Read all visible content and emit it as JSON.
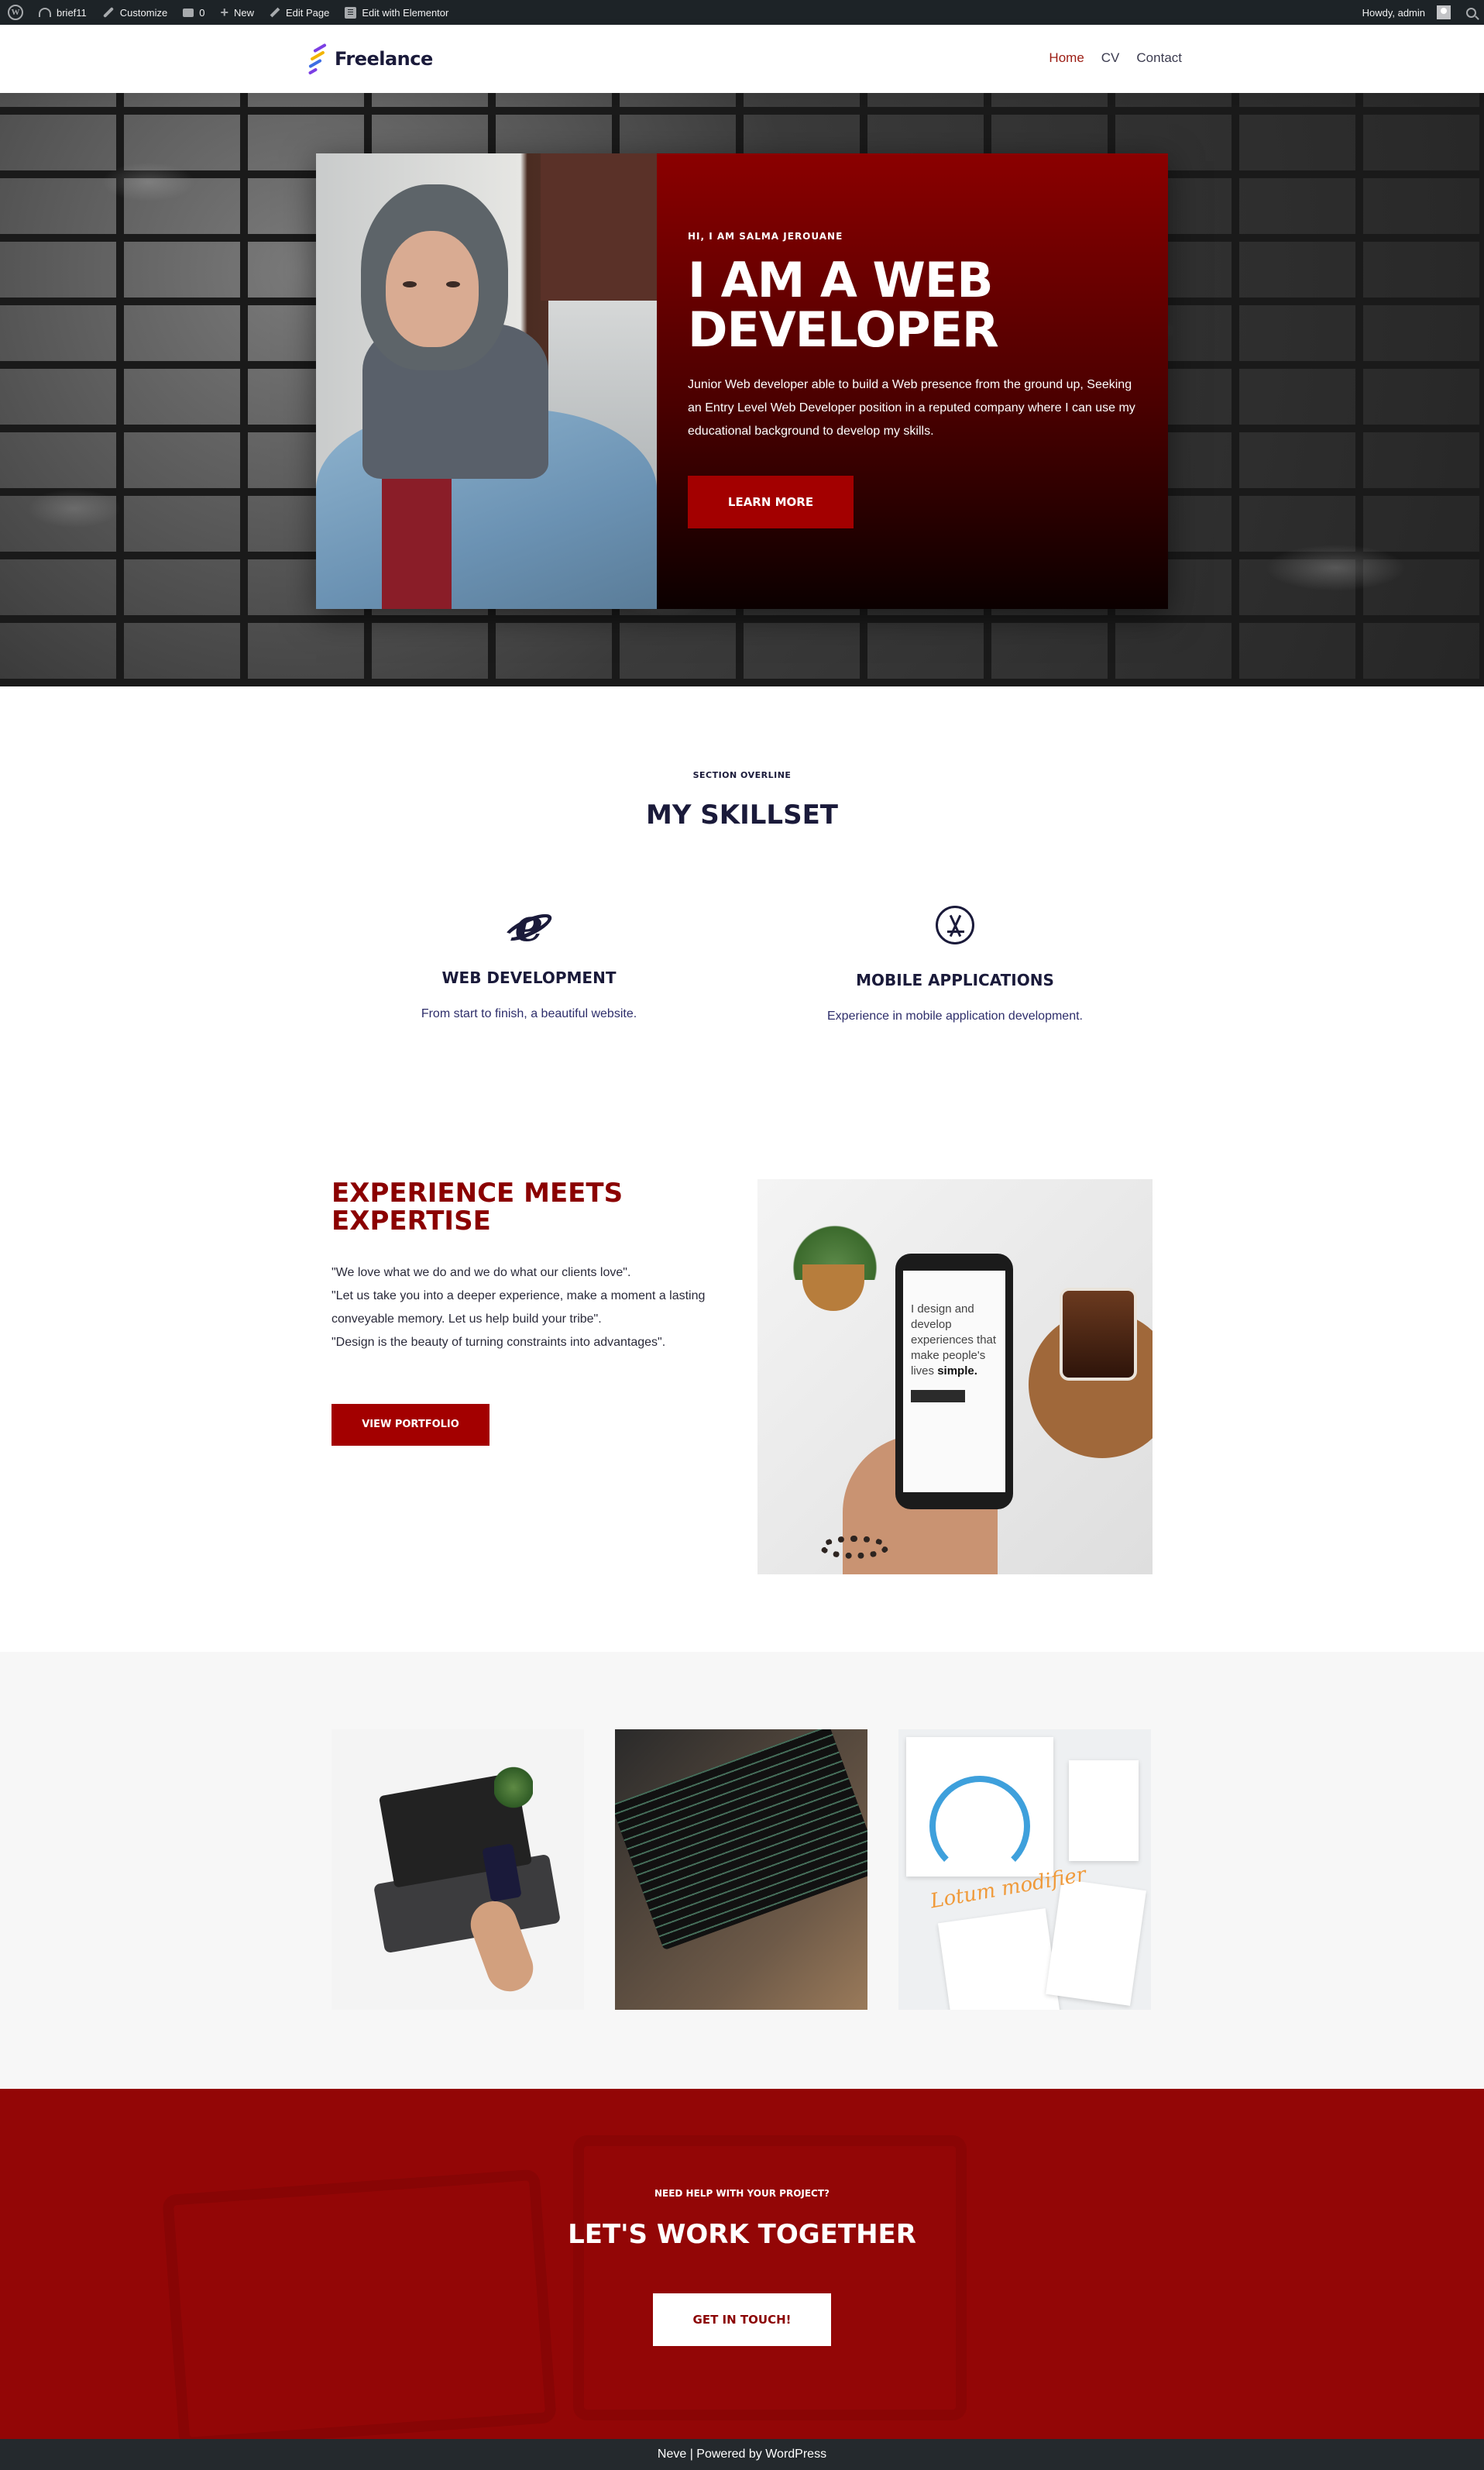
{
  "admin_bar": {
    "site_name": "brief11",
    "customize": "Customize",
    "comments_count": "0",
    "new": "New",
    "edit_page": "Edit Page",
    "edit_elementor": "Edit with Elementor",
    "howdy": "Howdy, admin"
  },
  "header": {
    "logo_text": "Freelance",
    "nav": [
      {
        "label": "Home",
        "active": true
      },
      {
        "label": "CV",
        "active": false
      },
      {
        "label": "Contact",
        "active": false
      }
    ]
  },
  "hero": {
    "kicker": "HI, I AM SALMA JEROUANE",
    "title": "I AM A WEB DEVELOPER",
    "text": "Junior Web developer able to build a Web presence from the ground up, Seeking an Entry Level Web Developer position in a reputed company where I can use my educational background to develop my skills.",
    "button": "LEARN MORE"
  },
  "skillset": {
    "overline": "SECTION OVERLINE",
    "title": "MY SKILLSET",
    "items": [
      {
        "icon": "internet-explorer-icon",
        "title": "WEB DEVELOPMENT",
        "text": "From start to finish, a beautiful website."
      },
      {
        "icon": "app-store-icon",
        "title": "MOBILE APPLICATIONS",
        "text": "Experience in mobile application development."
      }
    ]
  },
  "experience": {
    "title": "EXPERIENCE MEETS EXPERTISE",
    "quotes": [
      "\"We love what we do and we do what our clients love\".",
      "\"Let us take you into a deeper experience, make a moment a lasting conveyable memory. Let us help build your tribe\".",
      "\"Design is the beauty of turning constraints into advantages\"."
    ],
    "button": "VIEW PORTFOLIO",
    "phone_text": "I design and develop experiences that make people's lives",
    "phone_bold": "simple."
  },
  "gallery": {
    "script_text": "Lotum modifier"
  },
  "cta": {
    "overline": "NEED HELP WITH YOUR PROJECT?",
    "title": "LET'S WORK TOGETHER",
    "button": "GET IN TOUCH!"
  },
  "footer": {
    "text": "Neve | Powered by WordPress"
  },
  "colors": {
    "brand_red": "#8b0000",
    "button_red": "#a30000",
    "navy": "#1a1a3a",
    "admin_bar": "#1d2327"
  }
}
